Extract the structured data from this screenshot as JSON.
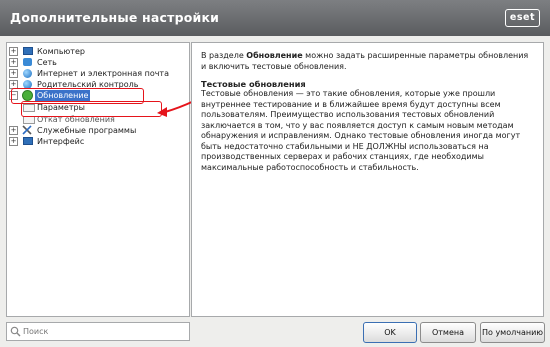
{
  "window": {
    "title": "Дополнительные настройки",
    "brand": "eset"
  },
  "tree": {
    "items": [
      {
        "label": "Компьютер"
      },
      {
        "label": "Сеть"
      },
      {
        "label": "Интернет и электронная почта"
      },
      {
        "label": "Родительский контроль"
      },
      {
        "label": "Обновление"
      },
      {
        "label": "Параметры"
      },
      {
        "label": "Откат обновления"
      },
      {
        "label": "Служебные программы"
      },
      {
        "label": "Интерфейс"
      }
    ]
  },
  "description": {
    "intro_prefix": "В разделе ",
    "intro_bold": "Обновление",
    "intro_suffix": " можно задать расширенные параметры обновления и включить тестовые обновления.",
    "heading": "Тестовые обновления",
    "body": "Тестовые обновления — это такие обновления, которые уже прошли внутреннее тестирование и в ближайшее время будут доступны всем пользователям. Преимущество использования тестовых обновлений заключается в том, что у вас появляется доступ к самым новым методам обнаружения и исправлениям. Однако тестовые обновления иногда могут быть недостаточно стабильными и НЕ ДОЛЖНЫ использоваться на производственных серверах и рабочих станциях, где необходимы максимальные работоспособность и стабильность."
  },
  "search": {
    "placeholder": "Поиск"
  },
  "buttons": {
    "ok": "OK",
    "cancel": "Отмена",
    "default": "По умолчанию"
  },
  "colors": {
    "annotation": "#e5141b",
    "selection": "#3a72c9",
    "titlebar": "#6b6d70"
  }
}
